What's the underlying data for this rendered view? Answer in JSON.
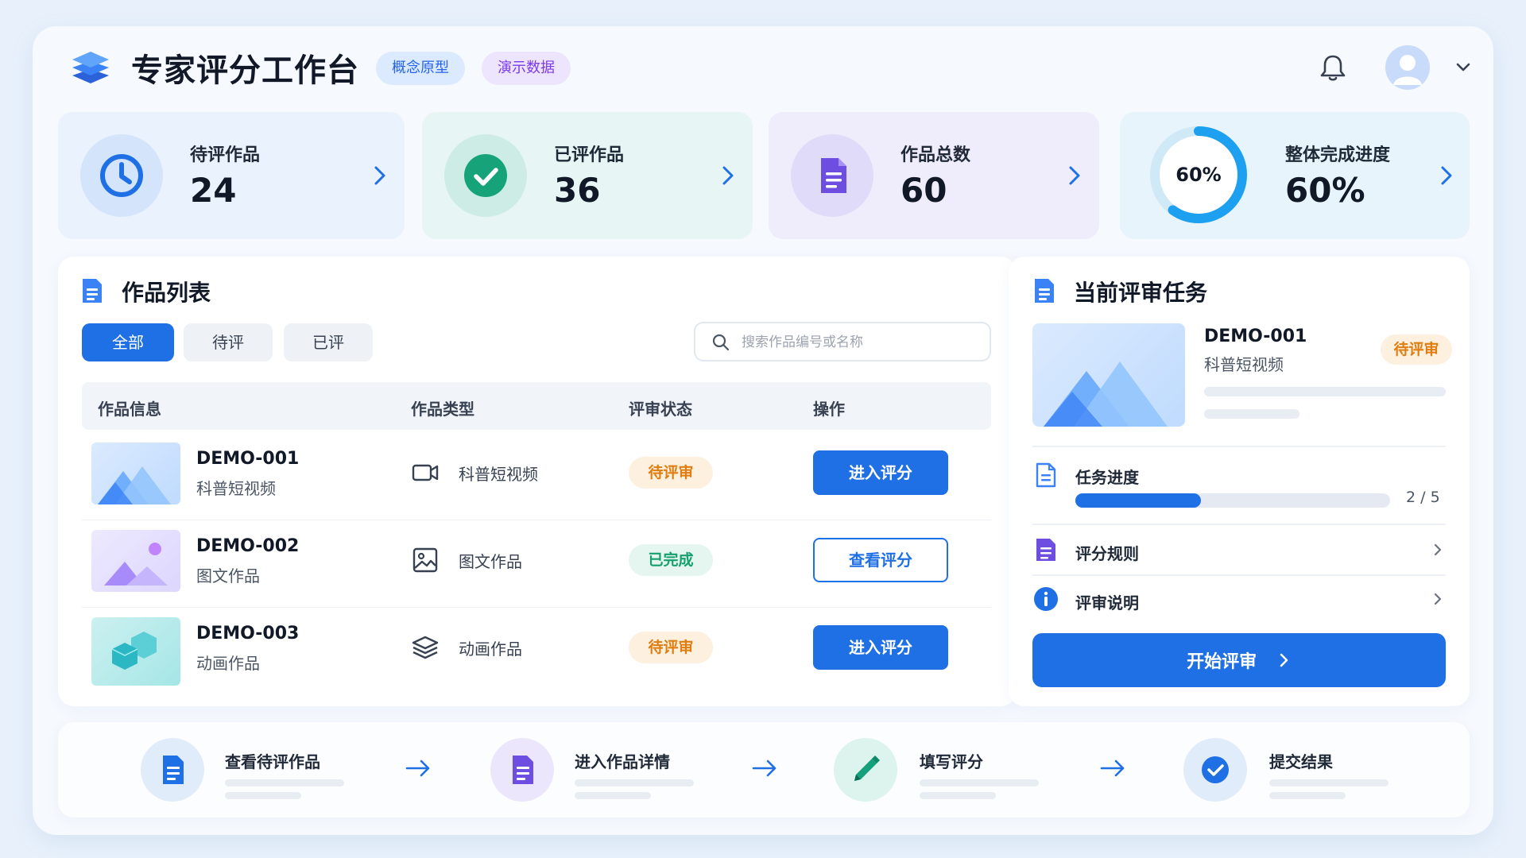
{
  "header": {
    "title": "专家评分工作台",
    "tags": [
      "概念原型",
      "演示数据"
    ]
  },
  "stats": [
    {
      "label": "待评作品",
      "value": "24",
      "icon": "clock-icon"
    },
    {
      "label": "已评作品",
      "value": "36",
      "icon": "check-icon"
    },
    {
      "label": "作品总数",
      "value": "60",
      "icon": "document-icon"
    },
    {
      "label": "整体完成进度",
      "value": "60%",
      "ring_label": "60%",
      "progress": 0.6,
      "icon": "progress-ring"
    }
  ],
  "works_list": {
    "title": "作品列表",
    "filters": [
      "全部",
      "待评",
      "已评"
    ],
    "active_filter": "全部",
    "search_placeholder": "搜索作品编号或名称",
    "columns": [
      "作品信息",
      "作品类型",
      "评审状态",
      "操作"
    ],
    "rows": [
      {
        "code": "DEMO-001",
        "name": "科普短视频",
        "type": "科普短视频",
        "type_icon": "video-icon",
        "status": "待评审",
        "action": "进入评分"
      },
      {
        "code": "DEMO-002",
        "name": "图文作品",
        "type": "图文作品",
        "type_icon": "image-icon",
        "status": "已完成",
        "action": "查看评分"
      },
      {
        "code": "DEMO-003",
        "name": "动画作品",
        "type": "动画作品",
        "type_icon": "layers-icon",
        "status": "待评审",
        "action": "进入评分"
      }
    ]
  },
  "current_task": {
    "title": "当前评审任务",
    "code": "DEMO-001",
    "name": "科普短视频",
    "status": "待评审",
    "progress_label": "任务进度",
    "progress_text": "2 / 5",
    "progress": 0.4,
    "links": [
      "评分规则",
      "评审说明"
    ],
    "start_label": "开始评审"
  },
  "flow_steps": [
    "查看待评作品",
    "进入作品详情",
    "填写评分",
    "提交结果"
  ],
  "colors": {
    "primary": "#1f6fe5",
    "pending": "#e07d10",
    "done": "#16a06f",
    "purple": "#7c3aed",
    "teal": "#14b8a6"
  }
}
